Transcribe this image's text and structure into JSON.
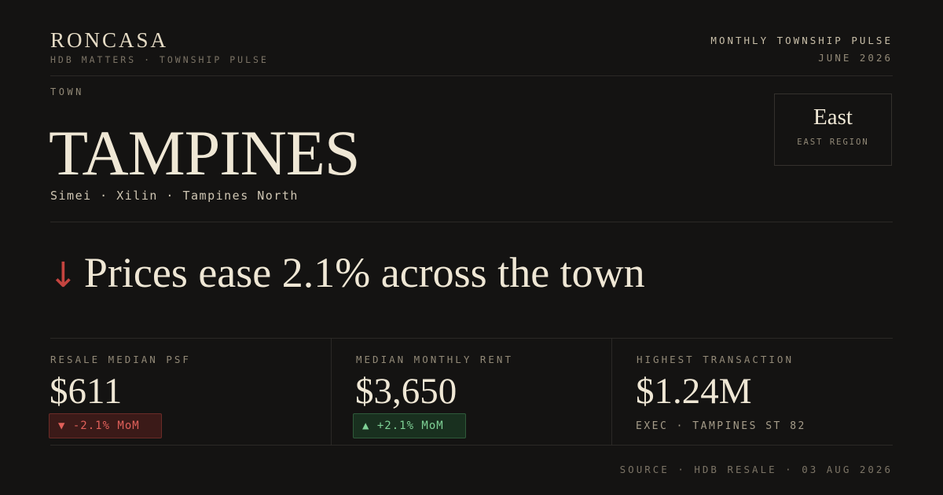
{
  "brand": {
    "name": "RONCASA",
    "tagline": "HDB MATTERS · TOWNSHIP PULSE"
  },
  "issue": {
    "title": "MONTHLY TOWNSHIP PULSE",
    "date": "JUNE 2026"
  },
  "town": {
    "label": "TOWN",
    "name": "TAMPINES",
    "neighbourhoods": "Simei · Xilin · Tampines North"
  },
  "region": {
    "name": "East",
    "label": "EAST REGION"
  },
  "headline": {
    "arrow": "↓",
    "text": "Prices ease 2.1% across the town",
    "accent_color": "#c4443f"
  },
  "stats": [
    {
      "label": "RESALE MEDIAN PSF",
      "value": "$611",
      "badge": "▼ -2.1% MoM",
      "direction": "down"
    },
    {
      "label": "MEDIAN MONTHLY RENT",
      "value": "$3,650",
      "badge": "▲ +2.1% MoM",
      "direction": "up"
    },
    {
      "label": "HIGHEST TRANSACTION",
      "value": "$1.24M",
      "note": "EXEC · TAMPINES ST 82"
    }
  ],
  "footer": {
    "source": "SOURCE · HDB RESALE · 03 AUG 2026"
  },
  "colors": {
    "background": "#141312",
    "text": "#ece4d2",
    "down": "#e0605a",
    "up": "#7fd196"
  }
}
